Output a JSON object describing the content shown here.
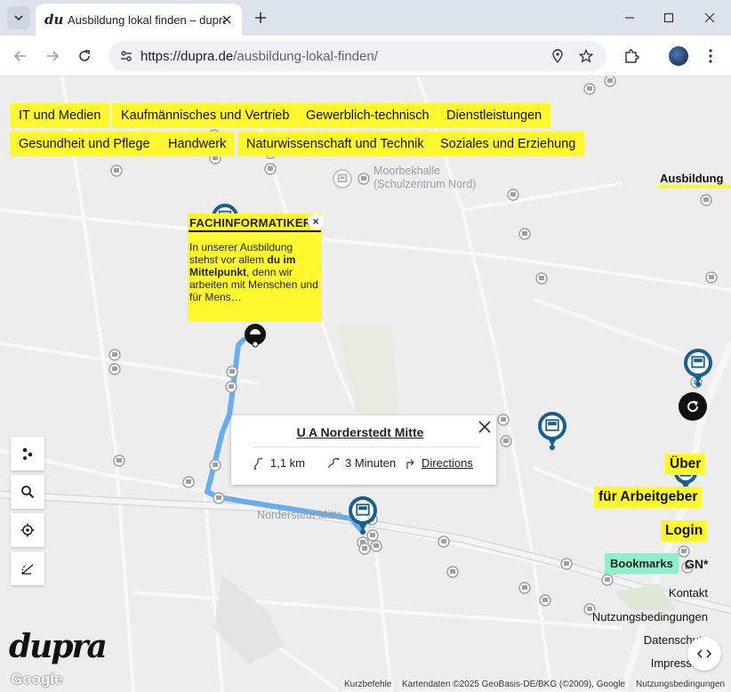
{
  "browser": {
    "tab_title": "Ausbildung lokal finden – dupra",
    "favicon_text": "du",
    "url_host": "https://dupra.de",
    "url_path": "/ausbildung-lokal-finden/"
  },
  "categories": [
    "IT und Medien",
    "Kaufmännisches und Vertrieb",
    "Gewerblich-technisch",
    "Dienstleistungen",
    "Gesundheit und Pflege",
    "Handwerk",
    "Naturwissenschaft und Technik",
    "Soziales und Erziehung"
  ],
  "map": {
    "place_moorbek": "Moorbekhalle",
    "place_moorbek_sub": "(Schulzentrum Nord)",
    "place_norderstedt": "Norderstedt Mitte",
    "route_color": "#5aa5ec",
    "pin_color": "#1a5f8c",
    "bus_stop_color": "#9aa0a6"
  },
  "popup": {
    "title": "FACHINFORMATIKER",
    "text_1": "In unserer Ausbildung stehst vor allem ",
    "text_bold": "du im Mittelpunkt",
    "text_2": ", denn wir arbeiten mit Menschen und für Mens…",
    "close": "×"
  },
  "info": {
    "title": "U A Norderstedt Mitte",
    "distance": "1,1 km",
    "duration": "3 Minuten",
    "directions": "Directions"
  },
  "side": {
    "ausbildung": "Ausbildung",
    "ueber": "Über",
    "arbeitgeber": "für Arbeitgeber",
    "login": "Login",
    "bookmarks": "Bookmarks",
    "gn": "GN*",
    "kontakt": "Kontakt",
    "nutzung": "Nutzungsbedingungen",
    "datenschutz": "Datenschutz",
    "impressum": "Impressum"
  },
  "footer": {
    "logo": "dupra",
    "google": "Google",
    "kurzbefehle": "Kurzbefehle",
    "kartendaten": "Kartendaten ©2025 GeoBasis-DE/BKG (©2009), Google",
    "nutzungsbedingungen": "Nutzungsbedingungen"
  },
  "colors": {
    "accent_yellow": "#fff82e",
    "bookmarks_green": "#8ff0c9"
  }
}
